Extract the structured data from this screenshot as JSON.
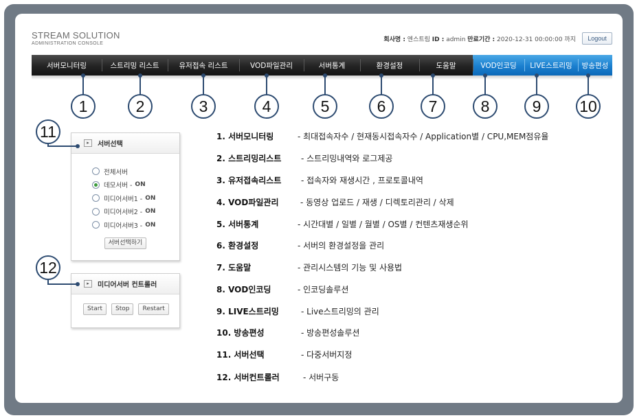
{
  "header": {
    "brand_title": "STREAM SOLUTION",
    "brand_sub": "ADMINISTRATION CONSOLE",
    "user_info": {
      "company_label": "회사명 :",
      "company": " 엔스트림 ",
      "id_label": "ID :",
      "id": " admin ",
      "expiry_label": "만료기간 :",
      "expiry": " 2020-12-31 00:00:00 까지"
    },
    "logout_label": "Logout"
  },
  "nav": [
    {
      "label": "서버모니터링"
    },
    {
      "label": "스트리밍 리스트"
    },
    {
      "label": "유저접속 리스트"
    },
    {
      "label": "VOD파일관리"
    },
    {
      "label": "서버통계"
    },
    {
      "label": "환경설정"
    },
    {
      "label": "도움말"
    },
    {
      "label": "VOD인코딩"
    },
    {
      "label": "LIVE스트리밍"
    },
    {
      "label": "방송편성"
    }
  ],
  "callouts": [
    "1",
    "2",
    "3",
    "4",
    "5",
    "6",
    "7",
    "8",
    "9",
    "10",
    "11",
    "12"
  ],
  "server_select": {
    "title": "서버선택",
    "options": [
      {
        "label": "전체서버",
        "status": "",
        "selected": false
      },
      {
        "label": "데모서버 -",
        "status": "ON",
        "selected": true
      },
      {
        "label": "미디어서버1 -",
        "status": "ON",
        "selected": false
      },
      {
        "label": "미디어서버2 -",
        "status": "ON",
        "selected": false
      },
      {
        "label": "미디어서버3 -",
        "status": "ON",
        "selected": false
      }
    ],
    "button": "서버선택하기"
  },
  "media_controller": {
    "title": "미디어서버 컨트롤러",
    "buttons": [
      "Start",
      "Stop",
      "Restart"
    ]
  },
  "descriptions": [
    {
      "key": "1. 서버모니터링",
      "value": "- 최대접속자수 / 현재동시접속자수  /  Application별  /  CPU,MEM점유율"
    },
    {
      "key": "2. 스트리밍리스트",
      "value": "- 스트리밍내역와  로그제공"
    },
    {
      "key": "3. 유저접속리스트",
      "value": "- 접속자와  재생시간 , 프로토콜내역"
    },
    {
      "key": "4. VOD파일관리",
      "value": "- 동영상 업로드  /  재생  /  디렉토리관리  /  삭제"
    },
    {
      "key": "5. 서버통계",
      "value": "- 시간대별  /  일별  /  월별  /  OS별  /  컨텐츠재생순위"
    },
    {
      "key": "6. 환경설정",
      "value": "- 서버의  환경설정을  관리"
    },
    {
      "key": "7. 도움말",
      "value": "- 관리시스템의  기능  및  사용법"
    },
    {
      "key": "8. VOD인코딩",
      "value": "-  인코딩솔루션"
    },
    {
      "key": "9. LIVE스트리밍",
      "value": "- Live스트리밍의  관리"
    },
    {
      "key": "10. 방송편성",
      "value": "- 방송편성솔루션"
    },
    {
      "key": "11. 서버선택",
      "value": "- 다중서버지정"
    },
    {
      "key": "12. 서버컨트롤러",
      "value": "- 서버구동"
    }
  ]
}
